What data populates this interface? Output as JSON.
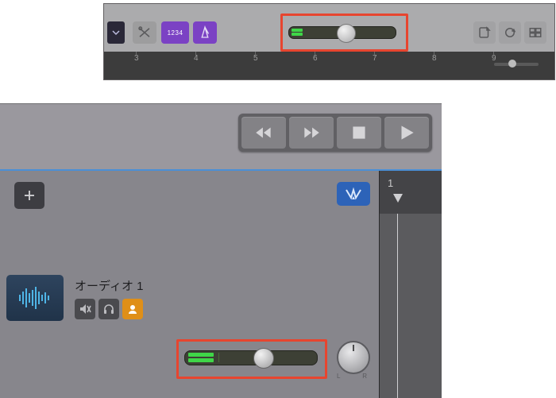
{
  "toolbar": {
    "numbers_label": "1234",
    "ruler_marks": [
      "3",
      "4",
      "5",
      "6",
      "7",
      "8",
      "9"
    ]
  },
  "transport": {
    "rewind": "rewind",
    "forward": "forward",
    "stop": "stop",
    "play": "play"
  },
  "tracks_header": {
    "bar_number": "1"
  },
  "track": {
    "name": "オーディオ 1",
    "pan_left": "L",
    "pan_right": "R"
  }
}
